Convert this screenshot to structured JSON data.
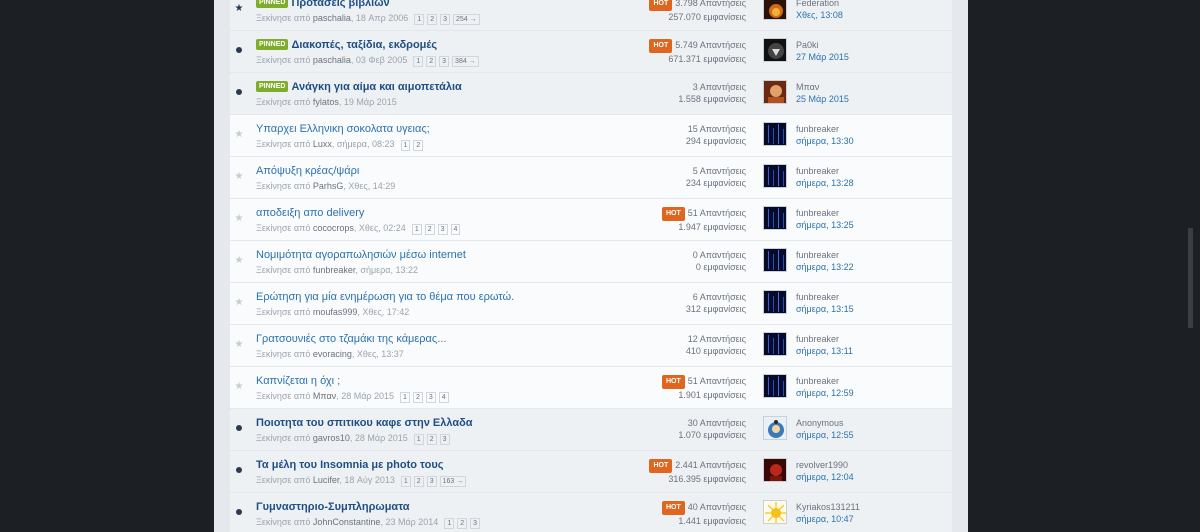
{
  "labels": {
    "pinned": "PINNED",
    "hot": "HOT"
  },
  "topics": [
    {
      "title": "Προτάσεις βιβλίων",
      "prefix": "Ξεκίνησε από",
      "author": "paschalia",
      "date": "18 Απρ 2006",
      "pages": [
        "1",
        "2",
        "3",
        "254 →"
      ],
      "pinned": true,
      "unread": true,
      "marker": "star",
      "hot": true,
      "replies": "3.798 Απαντήσεις",
      "views": "257.070 εμφανίσεις",
      "avatar": "fire",
      "last_user": "Federation",
      "last_time": "Χθες, 13:08"
    },
    {
      "title": "Διακοπές, ταξίδια, εκδρομές",
      "prefix": "Ξεκίνησε από",
      "author": "paschalia",
      "date": "03 Φεβ 2005",
      "pages": [
        "1",
        "2",
        "3",
        "384 →"
      ],
      "pinned": true,
      "unread": true,
      "marker": "dot",
      "hot": true,
      "replies": "5.749 Απαντήσεις",
      "views": "671.371 εμφανίσεις",
      "avatar": "dark",
      "last_user": "Pa0ki",
      "last_time": "27 Μάρ 2015"
    },
    {
      "title": "Ανάγκη για αίμα και αιμοπετάλια",
      "prefix": "Ξεκίνησε από",
      "author": "fylatos",
      "date": "19 Μάρ 2015",
      "pages": [],
      "pinned": true,
      "unread": true,
      "marker": "dot",
      "hot": false,
      "replies": "3 Απαντήσεις",
      "views": "1.558 εμφανίσεις",
      "avatar": "warm",
      "last_user": "Μπαν",
      "last_time": "25 Μάρ 2015"
    },
    {
      "title": "Υπαρχει Ελληνικη σοκολατα υγειας;",
      "prefix": "Ξεκίνησε από",
      "author": "Luxx",
      "date": "σήμερα, 08:23",
      "pages": [
        "1",
        "2"
      ],
      "pinned": false,
      "unread": false,
      "marker": "star",
      "hot": false,
      "replies": "15 Απαντήσεις",
      "views": "294 εμφανίσεις",
      "avatar": "matrix",
      "last_user": "funbreaker",
      "last_time": "σήμερα, 13:30"
    },
    {
      "title": "Απόψυξη κρέας/ψάρι",
      "prefix": "Ξεκίνησε από",
      "author": "ParhsG",
      "date": "Χθες, 14:29",
      "pages": [],
      "pinned": false,
      "unread": false,
      "marker": "star",
      "hot": false,
      "replies": "5 Απαντήσεις",
      "views": "234 εμφανίσεις",
      "avatar": "matrix",
      "last_user": "funbreaker",
      "last_time": "σήμερα, 13:28"
    },
    {
      "title": "αποδειξη απο delivery",
      "prefix": "Ξεκίνησε από",
      "author": "cococrops",
      "date": "Χθες, 02:24",
      "pages": [
        "1",
        "2",
        "3",
        "4"
      ],
      "pinned": false,
      "unread": false,
      "marker": "star",
      "hot": true,
      "replies": "51 Απαντήσεις",
      "views": "1.947 εμφανίσεις",
      "avatar": "matrix",
      "last_user": "funbreaker",
      "last_time": "σήμερα, 13:25"
    },
    {
      "title": "Νομιμότητα αγοραπωλησιών μέσω internet",
      "prefix": "Ξεκίνησε από",
      "author": "funbreaker",
      "date": "σήμερα, 13:22",
      "pages": [],
      "pinned": false,
      "unread": false,
      "marker": "star",
      "hot": false,
      "replies": "0 Απαντήσεις",
      "views": "0 εμφανίσεις",
      "avatar": "matrix",
      "last_user": "funbreaker",
      "last_time": "σήμερα, 13:22"
    },
    {
      "title": "Ερώτηση για μία ενημέρωση για το θέμα που ερωτώ.",
      "prefix": "Ξεκίνησε από",
      "author": "moufas999",
      "date": "Χθες, 17:42",
      "pages": [],
      "pinned": false,
      "unread": false,
      "marker": "star",
      "hot": false,
      "replies": "6 Απαντήσεις",
      "views": "312 εμφανίσεις",
      "avatar": "matrix",
      "last_user": "funbreaker",
      "last_time": "σήμερα, 13:15"
    },
    {
      "title": "Γρατσουνιές στο τζαμάκι της κάμερας...",
      "prefix": "Ξεκίνησε από",
      "author": "evoracing",
      "date": "Χθες, 13:37",
      "pages": [],
      "pinned": false,
      "unread": false,
      "marker": "star",
      "hot": false,
      "replies": "12 Απαντήσεις",
      "views": "410 εμφανίσεις",
      "avatar": "matrix",
      "last_user": "funbreaker",
      "last_time": "σήμερα, 13:11"
    },
    {
      "title": "Καπνίζεται η όχι ;",
      "prefix": "Ξεκίνησε από",
      "author": "Μπαν",
      "date": "28 Μάρ 2015",
      "pages": [
        "1",
        "2",
        "3",
        "4"
      ],
      "pinned": false,
      "unread": false,
      "marker": "star",
      "hot": true,
      "replies": "51 Απαντήσεις",
      "views": "1.901 εμφανίσεις",
      "avatar": "matrix",
      "last_user": "funbreaker",
      "last_time": "σήμερα, 12:59"
    },
    {
      "title": "Ποιοτητα του σπιτικου καφε στην Ελλαδα",
      "prefix": "Ξεκίνησε από",
      "author": "gavros10",
      "date": "28 Μάρ 2015",
      "pages": [
        "1",
        "2",
        "3"
      ],
      "pinned": false,
      "unread": true,
      "marker": "dot",
      "hot": false,
      "replies": "30 Απαντήσεις",
      "views": "1.070 εμφανίσεις",
      "avatar": "anon",
      "last_user": "Anonymous",
      "last_time": "σήμερα, 12:55"
    },
    {
      "title": "Τα μέλη του Insomnia με photo τους",
      "prefix": "Ξεκίνησε από",
      "author": "Lucifer",
      "date": "18 Αύγ 2013",
      "pages": [
        "1",
        "2",
        "3",
        "163 →"
      ],
      "pinned": false,
      "unread": true,
      "marker": "dot",
      "hot": true,
      "replies": "2.441 Απαντήσεις",
      "views": "316.395 εμφανίσεις",
      "avatar": "red",
      "last_user": "revolver1990",
      "last_time": "σήμερα, 12:04"
    },
    {
      "title": "Γυμναστηριο-Συμπληρωματα",
      "prefix": "Ξεκίνησε από",
      "author": "JohnConstantine",
      "date": "23 Μάρ 2014",
      "pages": [
        "1",
        "2",
        "3"
      ],
      "pinned": false,
      "unread": true,
      "marker": "dot",
      "hot": true,
      "replies": "40 Απαντήσεις",
      "views": "1.441 εμφανίσεις",
      "avatar": "sun",
      "last_user": "Kyriakos131211",
      "last_time": "σήμερα, 10:47"
    }
  ]
}
